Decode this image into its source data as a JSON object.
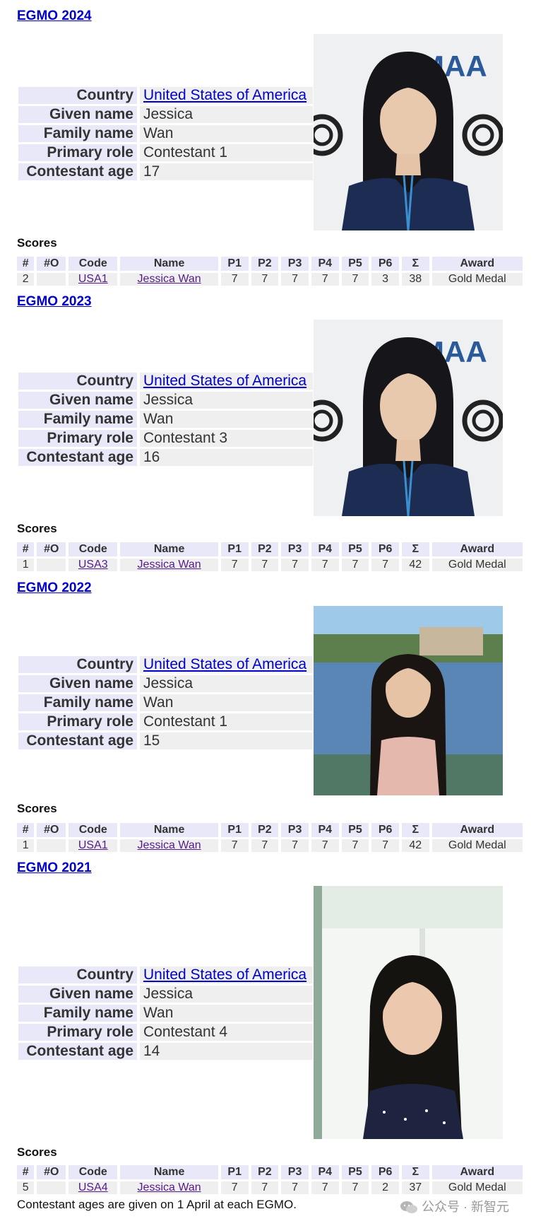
{
  "labels": {
    "country": "Country",
    "given_name": "Given name",
    "family_name": "Family name",
    "primary_role": "Primary role",
    "contestant_age": "Contestant age",
    "scores": "Scores"
  },
  "score_headers": [
    "#",
    "#O",
    "Code",
    "Name",
    "P1",
    "P2",
    "P3",
    "P4",
    "P5",
    "P6",
    "Σ",
    "Award"
  ],
  "sections": [
    {
      "title": "EGMO 2024",
      "country": "United States of America",
      "given_name": "Jessica",
      "family_name": "Wan",
      "primary_role": "Contestant 1",
      "contestant_age": "17",
      "photo": "portrait-press-backdrop",
      "scores": [
        "2",
        "",
        "USA1",
        "Jessica Wan",
        "7",
        "7",
        "7",
        "7",
        "7",
        "3",
        "38",
        "Gold Medal"
      ]
    },
    {
      "title": "EGMO 2023",
      "country": "United States of America",
      "given_name": "Jessica",
      "family_name": "Wan",
      "primary_role": "Contestant 3",
      "contestant_age": "16",
      "photo": "portrait-press-backdrop",
      "scores": [
        "1",
        "",
        "USA3",
        "Jessica Wan",
        "7",
        "7",
        "7",
        "7",
        "7",
        "7",
        "42",
        "Gold Medal"
      ]
    },
    {
      "title": "EGMO 2022",
      "country": "United States of America",
      "given_name": "Jessica",
      "family_name": "Wan",
      "primary_role": "Contestant 1",
      "contestant_age": "15",
      "photo": "portrait-lake",
      "scores": [
        "1",
        "",
        "USA1",
        "Jessica Wan",
        "7",
        "7",
        "7",
        "7",
        "7",
        "7",
        "42",
        "Gold Medal"
      ]
    },
    {
      "title": "EGMO 2021",
      "country": "United States of America",
      "given_name": "Jessica",
      "family_name": "Wan",
      "primary_role": "Contestant 4",
      "contestant_age": "14",
      "photo": "portrait-window",
      "scores": [
        "5",
        "",
        "USA4",
        "Jessica Wan",
        "7",
        "7",
        "7",
        "7",
        "7",
        "2",
        "37",
        "Gold Medal"
      ]
    }
  ],
  "footnote": "Contestant ages are given on 1 April at each EGMO.",
  "watermark": "公众号 · 新智元"
}
